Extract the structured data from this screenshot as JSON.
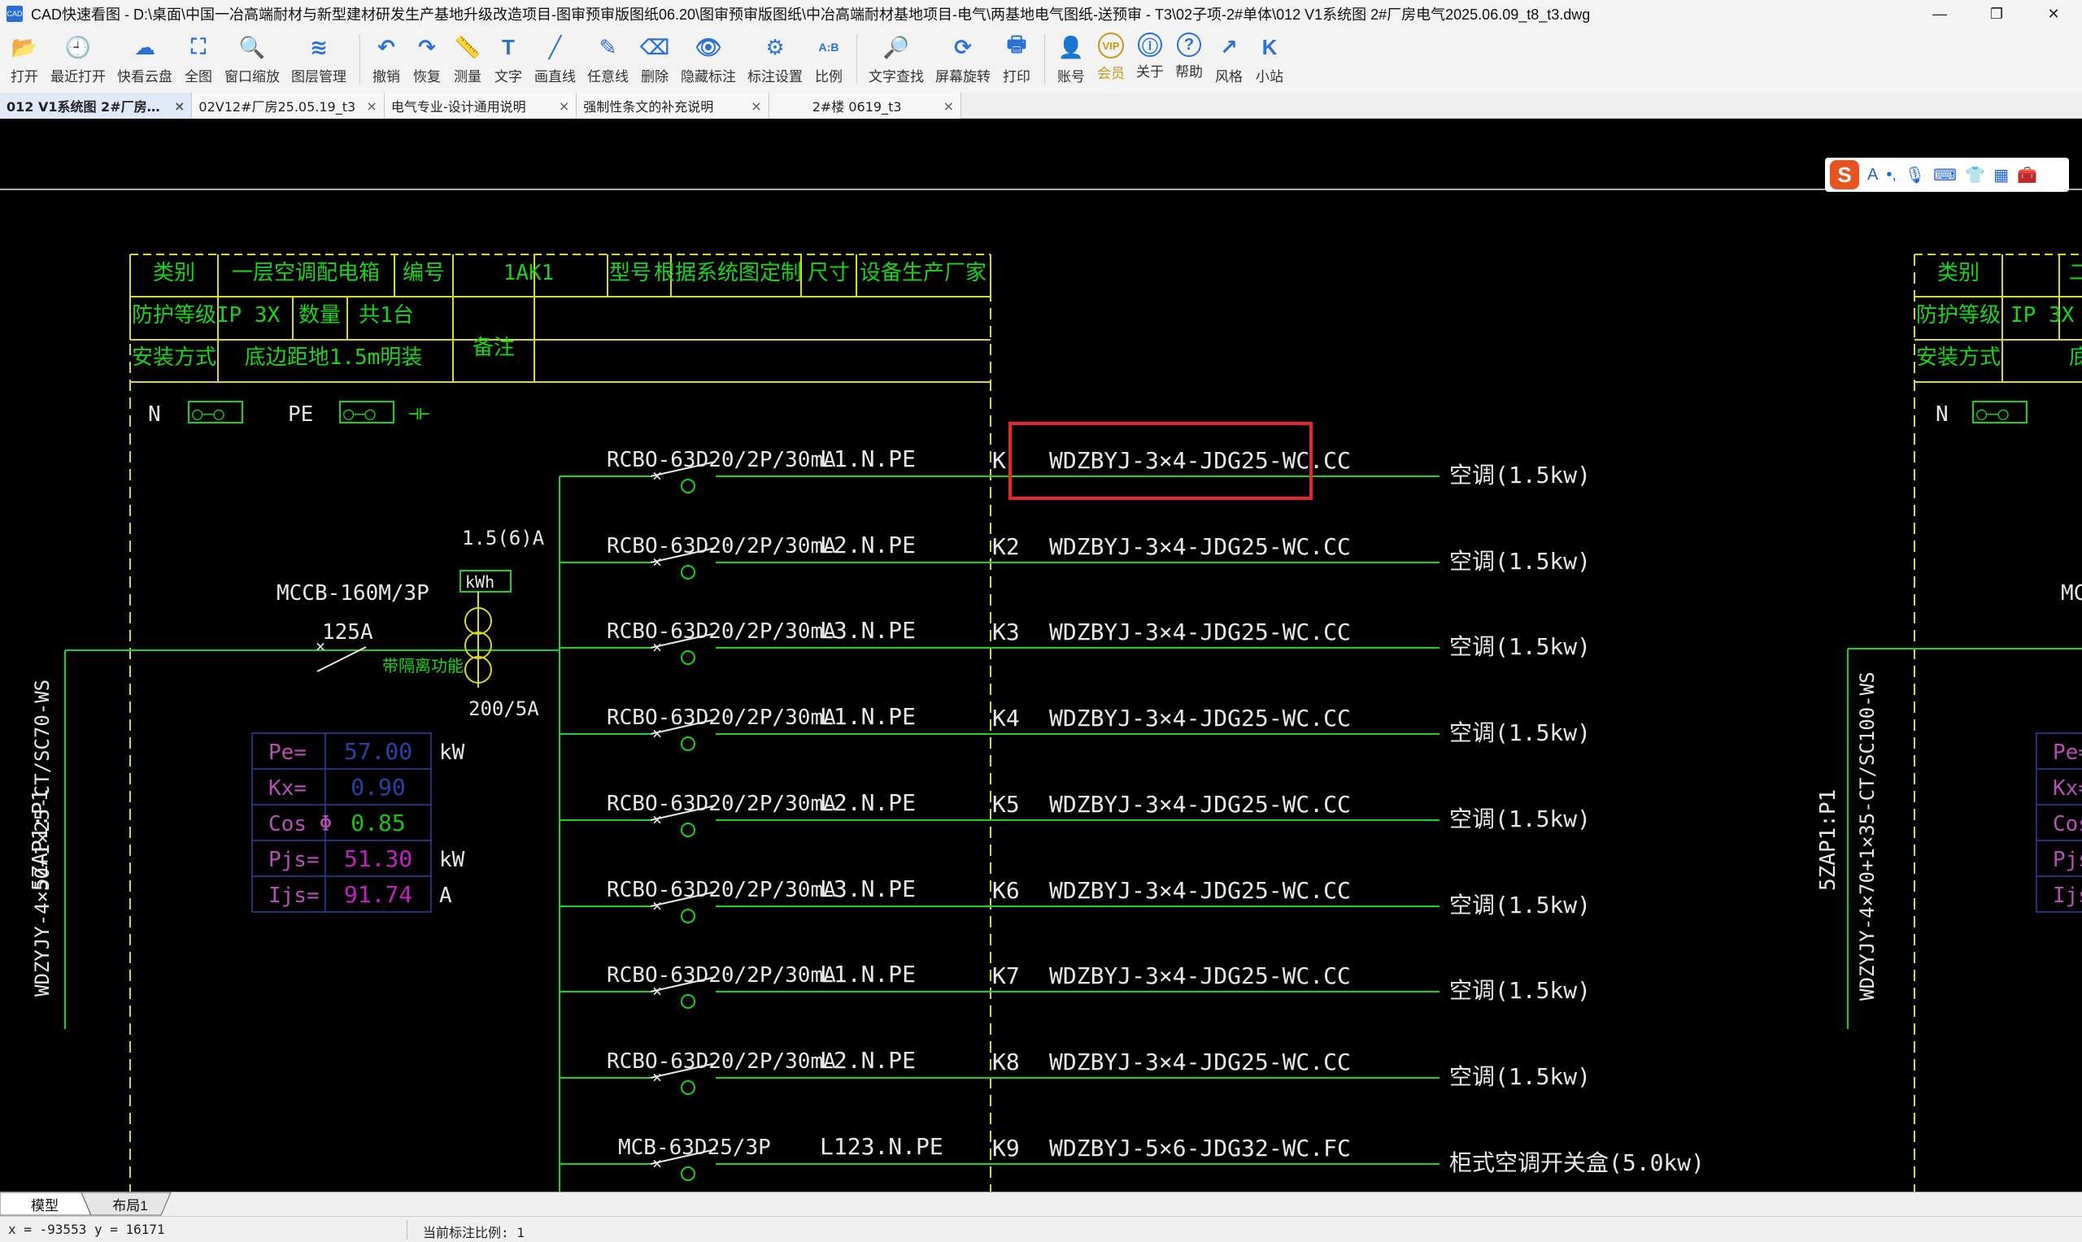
{
  "window": {
    "app_name": "CAD快速看图",
    "title": "CAD快速看图 - D:\\桌面\\中国一冶高端耐材与新型建材研发生产基地升级改造项目-图审预审版图纸06.20\\图审预审版图纸\\中冶高端耐材基地项目-电气\\两基地电气图纸-送预审 - T3\\02子项-2#单体\\012 V1系统图 2#厂房电气2025.06.09_t8_t3.dwg",
    "controls": {
      "minimize": "—",
      "restore": "❐",
      "close": "✕"
    }
  },
  "toolbar": [
    {
      "label": "打开",
      "icon": "folder-open-icon"
    },
    {
      "label": "最近打开",
      "icon": "recent-clock-icon"
    },
    {
      "label": "快看云盘",
      "icon": "cloud-icon"
    },
    {
      "label": "全图",
      "icon": "full-view-icon"
    },
    {
      "label": "窗口缩放",
      "icon": "window-zoom-icon"
    },
    {
      "label": "图层管理",
      "icon": "layers-icon"
    },
    {
      "label": "撤销",
      "icon": "undo-icon"
    },
    {
      "label": "恢复",
      "icon": "redo-icon"
    },
    {
      "label": "测量",
      "icon": "measure-icon"
    },
    {
      "label": "文字",
      "icon": "text-icon"
    },
    {
      "label": "画直线",
      "icon": "line-icon"
    },
    {
      "label": "任意线",
      "icon": "freehand-icon"
    },
    {
      "label": "删除",
      "icon": "eraser-icon"
    },
    {
      "label": "隐藏标注",
      "icon": "hide-annotation-icon"
    },
    {
      "label": "标注设置",
      "icon": "annotation-settings-icon"
    },
    {
      "label": "比例",
      "icon": "scale-icon"
    },
    {
      "label": "文字查找",
      "icon": "text-search-icon"
    },
    {
      "label": "屏幕旋转",
      "icon": "screen-rotate-icon"
    },
    {
      "label": "打印",
      "icon": "printer-icon"
    },
    {
      "label": "账号",
      "icon": "account-icon"
    },
    {
      "label": "会员",
      "icon": "vip-icon"
    },
    {
      "label": "关于",
      "icon": "info-icon"
    },
    {
      "label": "帮助",
      "icon": "help-icon"
    },
    {
      "label": "风格",
      "icon": "style-icon"
    },
    {
      "label": "小站",
      "icon": "site-k-icon"
    }
  ],
  "tabs": [
    {
      "label": "012 V1系统图 2#厂房电气2025.06.09_t8_t3",
      "close": "×",
      "active": true
    },
    {
      "label": "02V12#厂房25.05.19_t3",
      "close": "×"
    },
    {
      "label": "电气专业-设计通用说明",
      "close": "×"
    },
    {
      "label": "强制性条文的补充说明",
      "close": "×"
    },
    {
      "label": "2#楼 0619_t3",
      "close": "×"
    }
  ],
  "ime_bar": {
    "logo": "S",
    "mode": "A",
    "icons": [
      "punctuation-icon",
      "microphone-icon",
      "keyboard-icon",
      "skin-icon",
      "grid-apps-icon",
      "toolbox-icon"
    ]
  },
  "drawing": {
    "header": {
      "row1": [
        "类别",
        "一层空调配电箱",
        "编号",
        "1AK1",
        "型号",
        "根据系统图定制",
        "尺寸",
        "设备生产厂家"
      ],
      "row2": [
        "防护等级",
        "IP 3X",
        "数量",
        "共1台",
        "备注"
      ],
      "row3": [
        "安装方式",
        "底边距地1.5m明装"
      ]
    },
    "bus": {
      "n": "N",
      "pe": "PE",
      "n_symbol": "○—○",
      "pe_symbol": "○—○",
      "ground": "⊣⊢"
    },
    "incoming": {
      "cable": "WDZYJY-4×50+1×25-CT/SC70-WS",
      "source": "5ZAP1:P1",
      "breaker": "MCCB-160M/3P",
      "rating": "125A",
      "note": "带隔离功能",
      "meter_rating": "1.5(6)A",
      "meter": "kWh",
      "ct": "200/5A"
    },
    "load_table": [
      {
        "label": "Pe=",
        "value": "57.00",
        "unit": "kW",
        "color": "#2b3fa8"
      },
      {
        "label": "Kx=",
        "value": "0.90",
        "unit": "",
        "color": "#2b3fa8"
      },
      {
        "label": "Cos Φ",
        "value": "0.85",
        "unit": "",
        "color": "#16c316"
      },
      {
        "label": "Pjs=",
        "value": "51.30",
        "unit": "kW",
        "color": "#c41fc4"
      },
      {
        "label": "Ijs=",
        "value": "91.74",
        "unit": "A",
        "color": "#c41fc4"
      }
    ],
    "circuits": [
      {
        "breaker": "RCBO-63D20/2P/30mA",
        "phase": "L1.N.PE",
        "id": "K",
        "cable": "WDZBYJ-3×4-JDG25-WC.CC",
        "load": "空调(1.5kw)",
        "highlight": true
      },
      {
        "breaker": "RCBO-63D20/2P/30mA",
        "phase": "L2.N.PE",
        "id": "K2",
        "cable": "WDZBYJ-3×4-JDG25-WC.CC",
        "load": "空调(1.5kw)"
      },
      {
        "breaker": "RCBO-63D20/2P/30mA",
        "phase": "L3.N.PE",
        "id": "K3",
        "cable": "WDZBYJ-3×4-JDG25-WC.CC",
        "load": "空调(1.5kw)"
      },
      {
        "breaker": "RCBO-63D20/2P/30mA",
        "phase": "L1.N.PE",
        "id": "K4",
        "cable": "WDZBYJ-3×4-JDG25-WC.CC",
        "load": "空调(1.5kw)"
      },
      {
        "breaker": "RCBO-63D20/2P/30mA",
        "phase": "L2.N.PE",
        "id": "K5",
        "cable": "WDZBYJ-3×4-JDG25-WC.CC",
        "load": "空调(1.5kw)"
      },
      {
        "breaker": "RCBO-63D20/2P/30mA",
        "phase": "L3.N.PE",
        "id": "K6",
        "cable": "WDZBYJ-3×4-JDG25-WC.CC",
        "load": "空调(1.5kw)"
      },
      {
        "breaker": "RCBO-63D20/2P/30mA",
        "phase": "L1.N.PE",
        "id": "K7",
        "cable": "WDZBYJ-3×4-JDG25-WC.CC",
        "load": "空调(1.5kw)"
      },
      {
        "breaker": "RCBO-63D20/2P/30mA",
        "phase": "L2.N.PE",
        "id": "K8",
        "cable": "WDZBYJ-3×4-JDG25-WC.CC",
        "load": "空调(1.5kw)"
      },
      {
        "breaker": "MCB-63D25/3P",
        "phase": "L123.N.PE",
        "id": "K9",
        "cable": "WDZBYJ-5×6-JDG32-WC.FC",
        "load": "柜式空调开关盒(5.0kw)"
      }
    ],
    "right_panel": {
      "row1": [
        "类别",
        "二层空"
      ],
      "row2": [
        "防护等级",
        "IP 3X"
      ],
      "row3": [
        "安装方式",
        "底"
      ],
      "n": "N",
      "n_symbol": "○—○",
      "cable": "WDZYJY-4×70+1×35-CT/SC100-WS",
      "source": "5ZAP1:P1",
      "breaker_partial": "MC",
      "load_labels": [
        "Pe=",
        "Kx=",
        "Cos Φ",
        "Pjs=",
        "Ijs="
      ]
    }
  },
  "layout_tabs": {
    "model": "模型",
    "layout1": "布局1"
  },
  "status": {
    "coords": "x = -93553  y = 16171",
    "scale": "当前标注比例: 1"
  }
}
